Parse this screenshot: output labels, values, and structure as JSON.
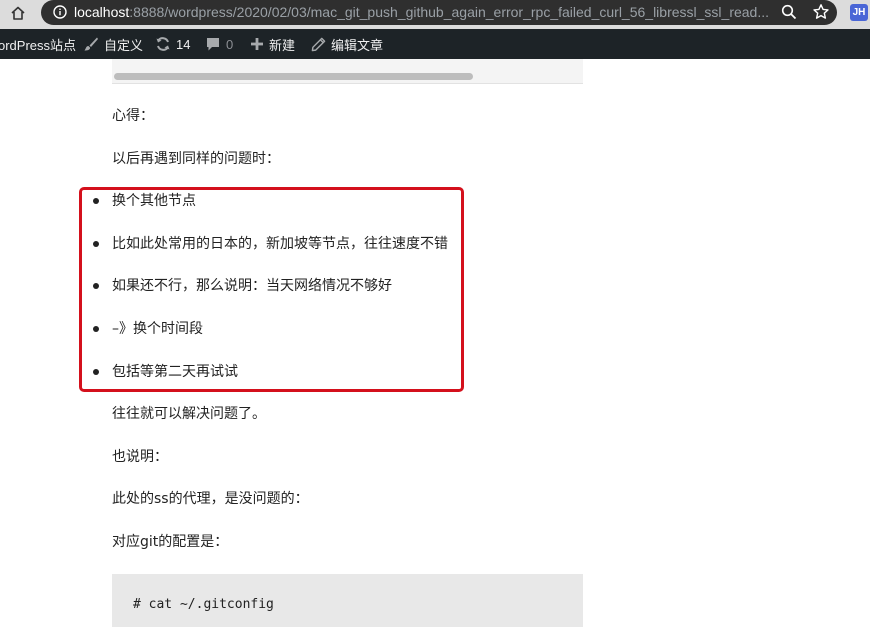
{
  "browser": {
    "url_host": "localhost",
    "url_rest": ":8888/wordpress/2020/02/03/mac_git_push_github_again_error_rpc_failed_curl_56_libressl_ssl_read...",
    "profile_initials": "JH"
  },
  "admin_bar": {
    "site_label": "ordPress站点",
    "customize_label": "自定义",
    "updates_count": "14",
    "comments_count": "0",
    "new_label": "新建",
    "edit_label": "编辑文章"
  },
  "article": {
    "heading_1": "心得：",
    "heading_2": "以后再遇到同样的问题时：",
    "list_items": [
      "换个其他节点",
      "比如此处常用的日本的，新加坡等节点，往往速度不错",
      "如果还不行，那么说明：当天网络情况不够好",
      "–》换个时间段",
      "包括等第二天再试试"
    ],
    "para_3": "往往就可以解决问题了。",
    "para_4": "也说明：",
    "para_5": "此处的ss的代理，是没问题的：",
    "para_6": "对应git的配置是：",
    "code_line": "# cat ~/.gitconfig"
  },
  "colors": {
    "highlight_border": "#d4101c",
    "admin_bar_bg": "#1d2327",
    "omnibox_bg": "#2f2f2f",
    "profile_bg": "#4a66d6"
  }
}
